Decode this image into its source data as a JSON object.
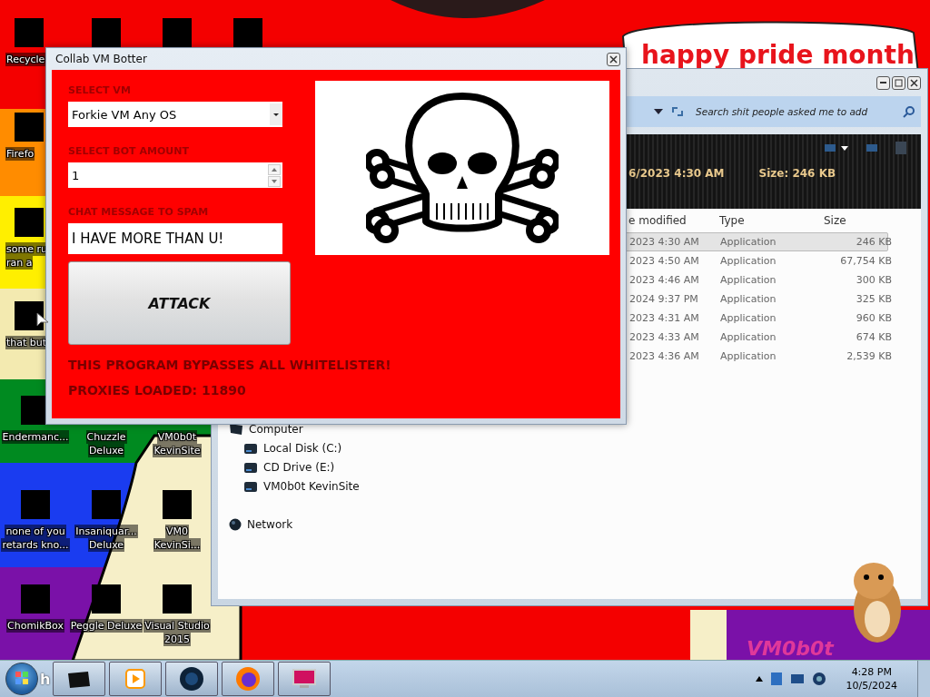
{
  "wallpaper": {
    "sign_text": "happy pride month",
    "logo_text": "VM0b0t"
  },
  "desktop_icons": [
    {
      "lines": [
        "Recycle"
      ]
    },
    {
      "lines": [
        "Firefo"
      ]
    },
    {
      "lines": [
        "some ru",
        "ran a"
      ]
    },
    {
      "lines": [
        "that but"
      ]
    },
    {
      "lines": [
        "Endermanc..."
      ]
    },
    {
      "lines": [
        "none of you",
        "retards kno..."
      ]
    },
    {
      "lines": [
        "ChomikBox"
      ]
    },
    {
      "lines": [
        "Chuzzle",
        "Deluxe"
      ]
    },
    {
      "lines": [
        "Insaniquar...",
        "Deluxe"
      ]
    },
    {
      "lines": [
        "Peggle Deluxe"
      ]
    },
    {
      "lines": [
        "VM0b0t",
        "KevinSite"
      ]
    },
    {
      "lines": [
        "VM0",
        "KevinSi..."
      ]
    },
    {
      "lines": [
        "Visual Studio",
        "2015"
      ]
    }
  ],
  "explorer": {
    "search": {
      "placeholder": "Search shit people asked me to add"
    },
    "details": {
      "modified": "6/2023 4:30 AM",
      "size": "Size: 246 KB"
    },
    "columns": [
      "e modified",
      "Type",
      "Size"
    ],
    "rows": [
      {
        "modified": "2023 4:30 AM",
        "type": "Application",
        "size": "246 KB",
        "selected": true
      },
      {
        "modified": "2023 4:50 AM",
        "type": "Application",
        "size": "67,754 KB",
        "selected": false
      },
      {
        "modified": "2023 4:46 AM",
        "type": "Application",
        "size": "300 KB",
        "selected": false
      },
      {
        "modified": "2024 9:37 PM",
        "type": "Application",
        "size": "325 KB",
        "selected": false
      },
      {
        "modified": "2023 4:31 AM",
        "type": "Application",
        "size": "960 KB",
        "selected": false
      },
      {
        "modified": "2023 4:33 AM",
        "type": "Application",
        "size": "674 KB",
        "selected": false
      },
      {
        "modified": "2023 4:36 AM",
        "type": "Application",
        "size": "2,539 KB",
        "selected": false
      }
    ],
    "tree": [
      {
        "label": "Computer",
        "kind": "computer",
        "children": [
          {
            "label": "Local Disk (C:)",
            "kind": "drive"
          },
          {
            "label": "CD Drive (E:)",
            "kind": "drive"
          },
          {
            "label": "VM0b0t KevinSite",
            "kind": "drive"
          }
        ]
      },
      {
        "label": "Network",
        "kind": "network"
      }
    ]
  },
  "dialog": {
    "title": "Collab VM Botter",
    "vm_label": "SELECT VM",
    "vm_value": "Forkie VM Any OS",
    "bot_label": "SELECT BOT AMOUNT",
    "bot_value": "1",
    "message_label": "CHAT MESSAGE TO SPAM",
    "message_value": "I HAVE MORE THAN U!",
    "button": "ATTACK",
    "notes": [
      "THIS PROGRAM BYPASSES ALL WHITELISTER!",
      "PROXIES LOADED: 11890"
    ]
  },
  "taskbar": {
    "start_letter": "h",
    "time": "4:28 PM",
    "date": "10/5/2024"
  }
}
